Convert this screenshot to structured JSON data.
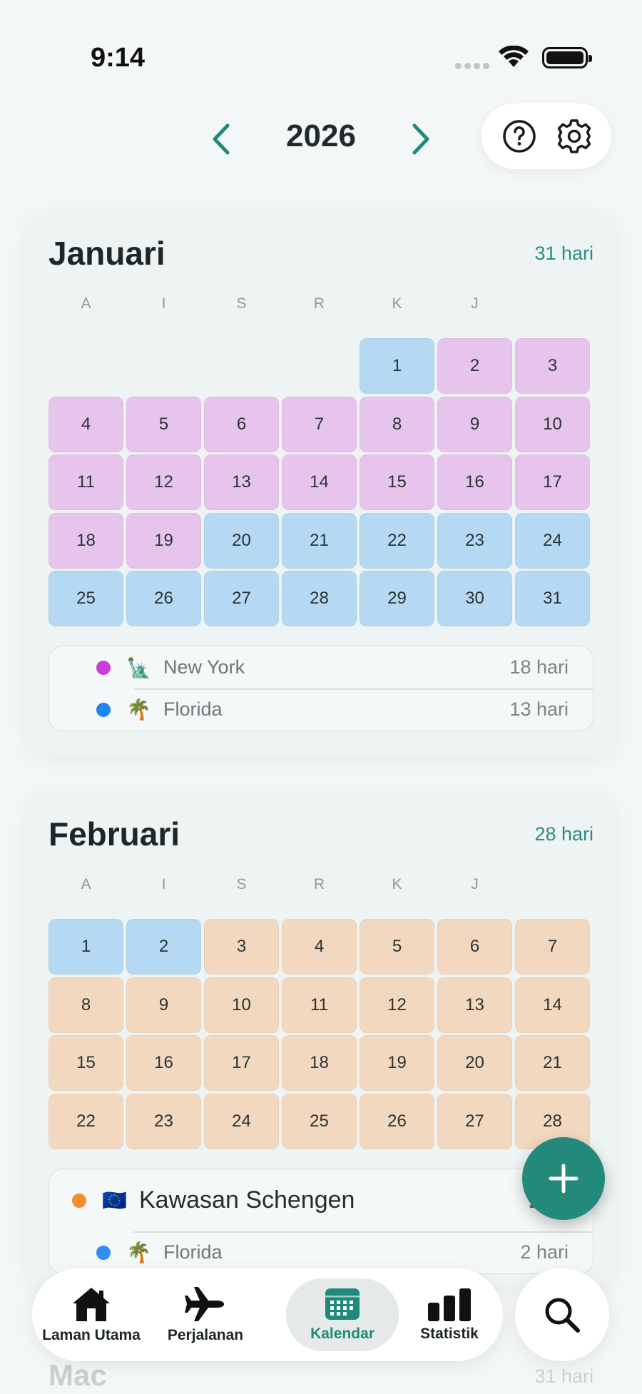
{
  "status": {
    "time": "9:14"
  },
  "header": {
    "year": "2026"
  },
  "weekdays": [
    "A",
    "I",
    "S",
    "R",
    "K",
    "J",
    ""
  ],
  "january": {
    "title": "Januari",
    "days_label": "31 hari",
    "offset": 4,
    "days": [
      {
        "n": "1",
        "c": "blue"
      },
      {
        "n": "2",
        "c": "pink"
      },
      {
        "n": "3",
        "c": "pink"
      },
      {
        "n": "4",
        "c": "pink"
      },
      {
        "n": "5",
        "c": "pink"
      },
      {
        "n": "6",
        "c": "pink"
      },
      {
        "n": "7",
        "c": "pink"
      },
      {
        "n": "8",
        "c": "pink"
      },
      {
        "n": "9",
        "c": "pink"
      },
      {
        "n": "10",
        "c": "pink"
      },
      {
        "n": "11",
        "c": "pink"
      },
      {
        "n": "12",
        "c": "pink"
      },
      {
        "n": "13",
        "c": "pink"
      },
      {
        "n": "14",
        "c": "pink"
      },
      {
        "n": "15",
        "c": "pink"
      },
      {
        "n": "16",
        "c": "pink"
      },
      {
        "n": "17",
        "c": "pink"
      },
      {
        "n": "18",
        "c": "pink"
      },
      {
        "n": "19",
        "c": "pink"
      },
      {
        "n": "20",
        "c": "blue"
      },
      {
        "n": "21",
        "c": "blue"
      },
      {
        "n": "22",
        "c": "blue"
      },
      {
        "n": "23",
        "c": "blue"
      },
      {
        "n": "24",
        "c": "blue"
      },
      {
        "n": "25",
        "c": "blue"
      },
      {
        "n": "26",
        "c": "blue"
      },
      {
        "n": "27",
        "c": "blue"
      },
      {
        "n": "28",
        "c": "blue"
      },
      {
        "n": "29",
        "c": "blue"
      },
      {
        "n": "30",
        "c": "blue"
      },
      {
        "n": "31",
        "c": "blue"
      }
    ],
    "legend": [
      {
        "dot": "#c93fd6",
        "emoji": "🗽",
        "name": "New York",
        "count": "18 hari"
      },
      {
        "dot": "#1f86f0",
        "emoji": "🌴",
        "name": "Florida",
        "count": "13 hari"
      }
    ]
  },
  "february": {
    "title": "Februari",
    "days_label": "28 hari",
    "offset": 0,
    "days": [
      {
        "n": "1",
        "c": "blue"
      },
      {
        "n": "2",
        "c": "blue"
      },
      {
        "n": "3",
        "c": "peach"
      },
      {
        "n": "4",
        "c": "peach"
      },
      {
        "n": "5",
        "c": "peach"
      },
      {
        "n": "6",
        "c": "peach"
      },
      {
        "n": "7",
        "c": "peach"
      },
      {
        "n": "8",
        "c": "peach"
      },
      {
        "n": "9",
        "c": "peach"
      },
      {
        "n": "10",
        "c": "peach"
      },
      {
        "n": "11",
        "c": "peach"
      },
      {
        "n": "12",
        "c": "peach"
      },
      {
        "n": "13",
        "c": "peach"
      },
      {
        "n": "14",
        "c": "peach"
      },
      {
        "n": "15",
        "c": "peach"
      },
      {
        "n": "16",
        "c": "peach"
      },
      {
        "n": "17",
        "c": "peach"
      },
      {
        "n": "18",
        "c": "peach"
      },
      {
        "n": "19",
        "c": "peach"
      },
      {
        "n": "20",
        "c": "peach"
      },
      {
        "n": "21",
        "c": "peach"
      },
      {
        "n": "22",
        "c": "peach"
      },
      {
        "n": "23",
        "c": "peach"
      },
      {
        "n": "24",
        "c": "peach"
      },
      {
        "n": "25",
        "c": "peach"
      },
      {
        "n": "26",
        "c": "peach"
      },
      {
        "n": "27",
        "c": "peach"
      },
      {
        "n": "28",
        "c": "peach"
      }
    ],
    "legend": [
      {
        "dot": "#f58c2e",
        "emoji": "🇪🇺",
        "name": "Kawasan Schengen",
        "count": "26 hari",
        "major": true
      },
      {
        "dot": "#2f8ff0",
        "emoji": "🌴",
        "name": "Florida",
        "count": "2 hari"
      }
    ]
  },
  "march": {
    "title": "Mac",
    "days_label": "31 hari"
  },
  "tabs": [
    {
      "label": "Laman Utama",
      "icon": "home-icon"
    },
    {
      "label": "Perjalanan",
      "icon": "airplane-icon"
    },
    {
      "label": "Kalendar",
      "icon": "calendar-icon",
      "active": true
    },
    {
      "label": "Statistik",
      "icon": "bar-chart-icon"
    }
  ],
  "colors": {
    "accent": "#23897a",
    "blue_day": "#b5d9f2",
    "pink_day": "#e6c4ec",
    "peach_day": "#f1d8bf"
  },
  "icons": [
    "chevron-left-icon",
    "chevron-right-icon",
    "help-icon",
    "gear-icon",
    "plus-icon",
    "search-icon",
    "wifi-icon",
    "battery-icon"
  ]
}
